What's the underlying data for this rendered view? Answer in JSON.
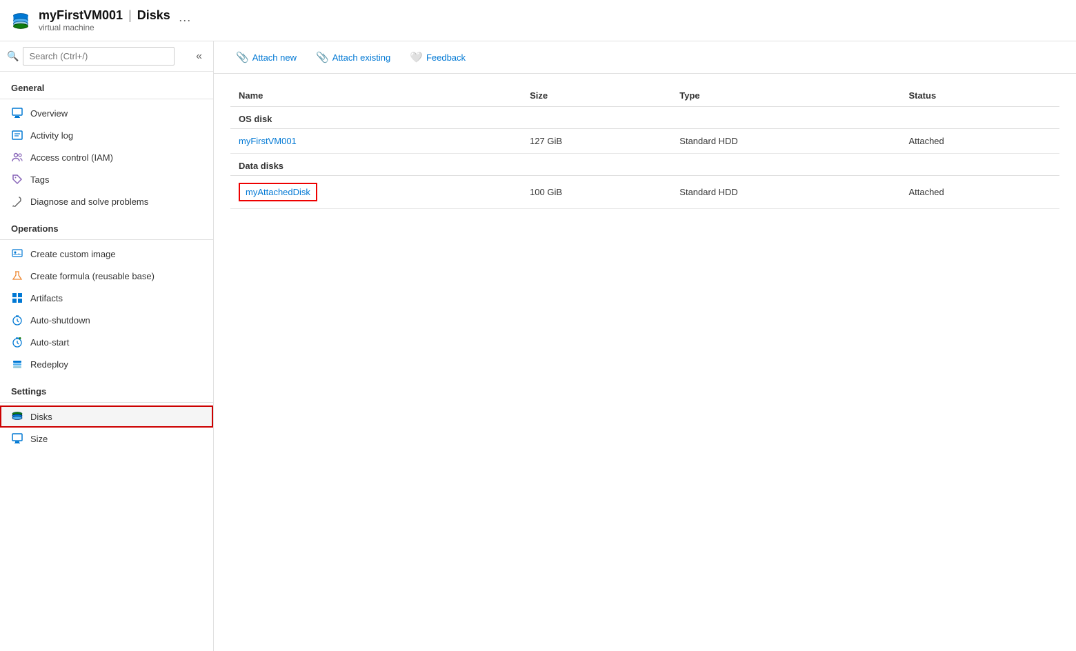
{
  "header": {
    "title": "myFirstVM001",
    "separator": "|",
    "page": "Disks",
    "subtitle": "virtual machine",
    "ellipsis": "···"
  },
  "search": {
    "placeholder": "Search (Ctrl+/)"
  },
  "sidebar": {
    "collapse_label": "«",
    "sections": [
      {
        "label": "General",
        "items": [
          {
            "id": "overview",
            "label": "Overview",
            "icon": "monitor"
          },
          {
            "id": "activity-log",
            "label": "Activity log",
            "icon": "list"
          },
          {
            "id": "access-control",
            "label": "Access control (IAM)",
            "icon": "people"
          },
          {
            "id": "tags",
            "label": "Tags",
            "icon": "tag"
          },
          {
            "id": "diagnose",
            "label": "Diagnose and solve problems",
            "icon": "wrench"
          }
        ]
      },
      {
        "label": "Operations",
        "items": [
          {
            "id": "create-image",
            "label": "Create custom image",
            "icon": "image"
          },
          {
            "id": "create-formula",
            "label": "Create formula (reusable base)",
            "icon": "flask"
          },
          {
            "id": "artifacts",
            "label": "Artifacts",
            "icon": "grid"
          },
          {
            "id": "auto-shutdown",
            "label": "Auto-shutdown",
            "icon": "clock"
          },
          {
            "id": "auto-start",
            "label": "Auto-start",
            "icon": "clock2"
          },
          {
            "id": "redeploy",
            "label": "Redeploy",
            "icon": "stack"
          }
        ]
      },
      {
        "label": "Settings",
        "items": [
          {
            "id": "disks",
            "label": "Disks",
            "icon": "disk",
            "active": true
          },
          {
            "id": "size",
            "label": "Size",
            "icon": "monitor2"
          }
        ]
      }
    ]
  },
  "toolbar": {
    "attach_new": "Attach new",
    "attach_existing": "Attach existing",
    "feedback": "Feedback"
  },
  "table": {
    "columns": [
      "Name",
      "Size",
      "Type",
      "Status"
    ],
    "sections": [
      {
        "section_label": "OS disk",
        "rows": [
          {
            "name": "myFirstVM001",
            "size": "127 GiB",
            "type": "Standard HDD",
            "status": "Attached",
            "highlighted": false
          }
        ]
      },
      {
        "section_label": "Data disks",
        "rows": [
          {
            "name": "myAttachedDisk",
            "size": "100 GiB",
            "type": "Standard HDD",
            "status": "Attached",
            "highlighted": true
          }
        ]
      }
    ]
  }
}
